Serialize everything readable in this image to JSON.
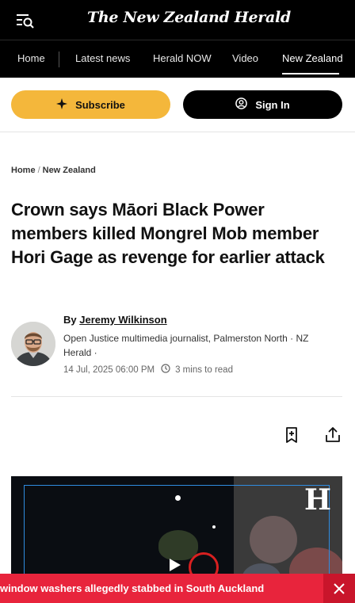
{
  "header": {
    "masthead": "The New Zealand Herald",
    "menu_icon": "menu-search-icon"
  },
  "nav": {
    "items": [
      {
        "label": "Home"
      },
      {
        "label": "Latest news"
      },
      {
        "label": "Herald NOW"
      },
      {
        "label": "Video"
      },
      {
        "label": "New Zealand",
        "active": true
      }
    ]
  },
  "actions": {
    "subscribe_label": "Subscribe",
    "subscribe_icon": "sparkle-icon",
    "signin_label": "Sign In",
    "signin_icon": "user-circle-icon"
  },
  "breadcrumb": {
    "home": "Home",
    "separator": "/",
    "section": "New Zealand"
  },
  "article": {
    "headline": "Crown says Māori Black Power members killed Mongrel Mob member Hori Gage as revenge for earlier attack",
    "byline_prefix": "By",
    "author": "Jeremy Wilkinson",
    "bio": "Open Justice multimedia journalist, Palmerston North · NZ Herald ·",
    "date": "14 Jul, 2025 06:00 PM",
    "read_time": "3 mins to read",
    "bookmark_icon": "bookmark-add-icon",
    "share_icon": "share-icon"
  },
  "video": {
    "logo": "H"
  },
  "alert": {
    "text": "window washers allegedly stabbed in South Auckland",
    "close_icon": "close-icon"
  },
  "colors": {
    "subscribe_bg": "#f4b73b",
    "alert_bg": "#e8243c",
    "header_bg": "#000000"
  }
}
